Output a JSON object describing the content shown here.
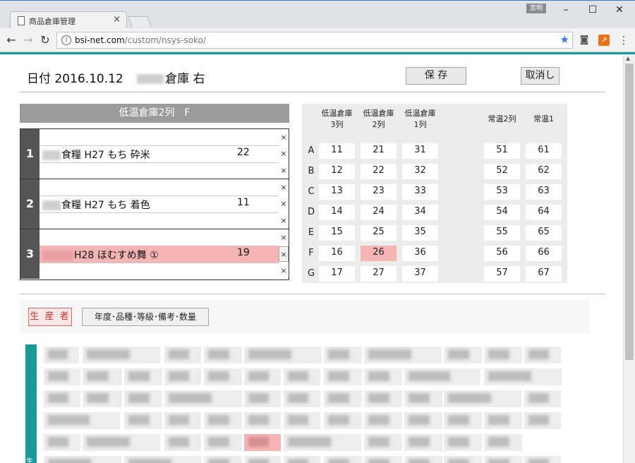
{
  "browser": {
    "tab_title": "商品倉庫管理",
    "user_badge": "宮明",
    "url_host": "bsi-net.com",
    "url_path": "/custom/nsys-soko/"
  },
  "header": {
    "date_label": "日付 2016.10.12",
    "warehouse_suffix": "倉庫 右",
    "save_label": "保 存",
    "cancel_label": "取消し"
  },
  "section": {
    "title": "低温倉庫2列　F"
  },
  "rows": [
    {
      "num": "1",
      "name": "食糧 H27 もち 砕米",
      "qty": "22",
      "highlight": false
    },
    {
      "num": "2",
      "name": "食糧 H27 もち 着色",
      "qty": "11",
      "highlight": false
    },
    {
      "num": "3",
      "name": "H28 ほむすめ舞 ①",
      "qty": "19",
      "highlight": true
    }
  ],
  "close_glyph": "×",
  "grid": {
    "columns": [
      {
        "line1": "低温倉庫",
        "line2": "3列"
      },
      {
        "line1": "低温倉庫",
        "line2": "2列"
      },
      {
        "line1": "低温倉庫",
        "line2": "1列"
      },
      {
        "line1": "常温2列",
        "line2": ""
      },
      {
        "line1": "常温1",
        "line2": ""
      }
    ],
    "rows": [
      {
        "label": "A",
        "cells": [
          "11",
          "21",
          "31",
          "51",
          "61"
        ]
      },
      {
        "label": "B",
        "cells": [
          "12",
          "22",
          "32",
          "52",
          "62"
        ]
      },
      {
        "label": "C",
        "cells": [
          "13",
          "23",
          "33",
          "53",
          "63"
        ]
      },
      {
        "label": "D",
        "cells": [
          "14",
          "24",
          "34",
          "54",
          "64"
        ]
      },
      {
        "label": "E",
        "cells": [
          "15",
          "25",
          "35",
          "55",
          "65"
        ]
      },
      {
        "label": "F",
        "cells": [
          "16",
          "26",
          "36",
          "56",
          "66"
        ]
      },
      {
        "label": "G",
        "cells": [
          "17",
          "27",
          "37",
          "57",
          "67"
        ]
      }
    ],
    "selected": "26"
  },
  "filters": {
    "producer_label": "生 産 者",
    "details_label": "年度･品種･等級･備考･数量"
  },
  "producers_side_label": "生",
  "colors": {
    "accent": "#1a9a96",
    "highlight": "#f5b5b5",
    "header_gray": "#9b9b9b"
  },
  "icons": [
    "page-icon",
    "close-icon",
    "back-icon",
    "forward-icon",
    "reload-icon",
    "info-icon",
    "star-icon",
    "camera-icon",
    "extension-icon",
    "menu-icon"
  ]
}
